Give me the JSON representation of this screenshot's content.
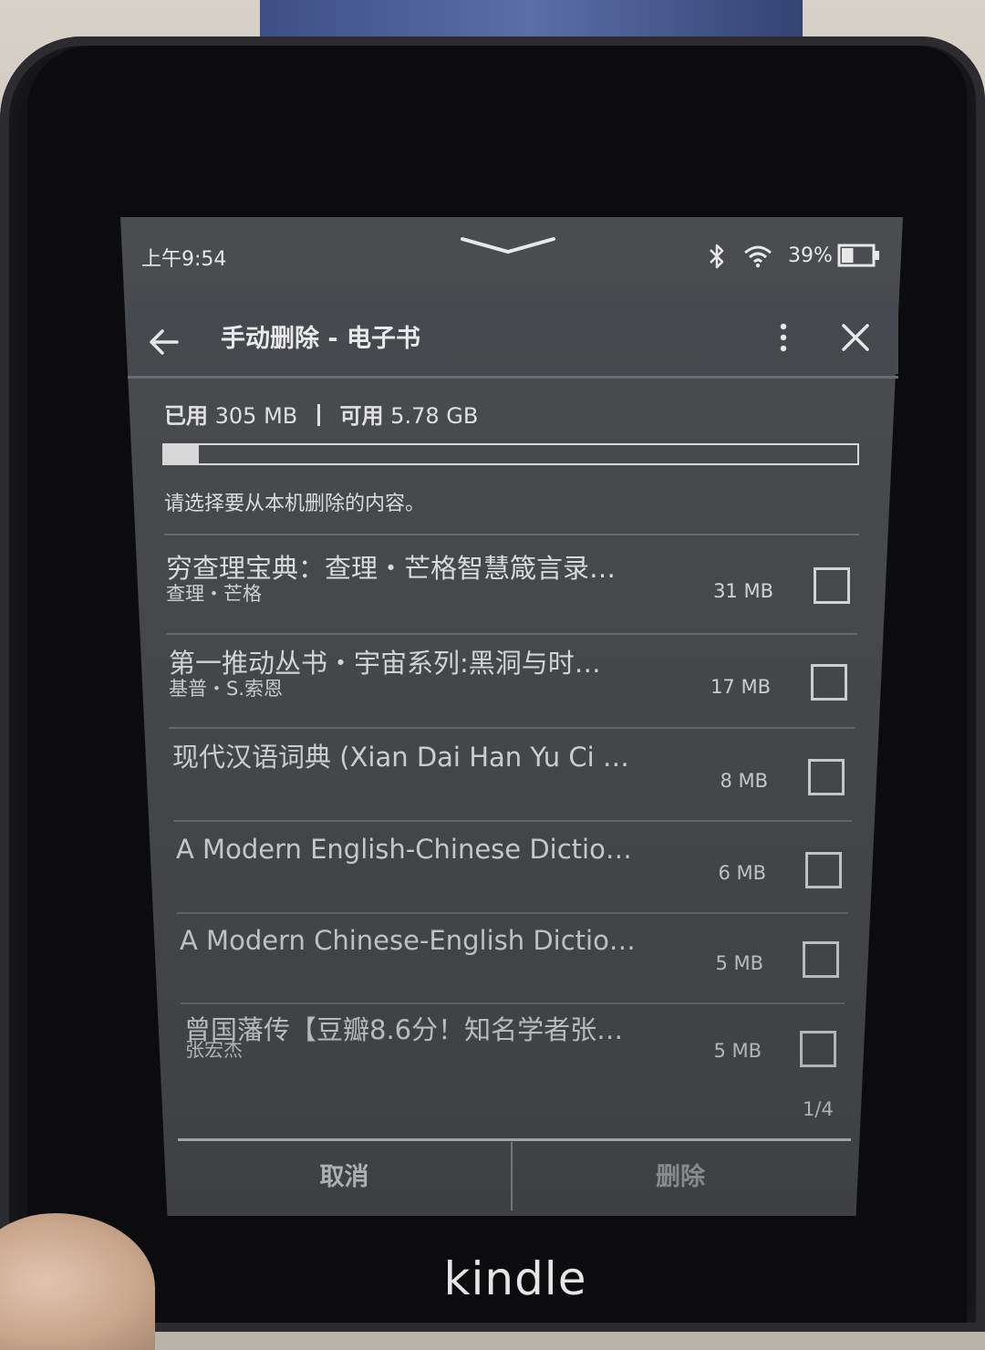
{
  "status_bar": {
    "time": "上午9:54",
    "battery_percent": "39%",
    "battery_level": 0.39
  },
  "header": {
    "title": "手动删除 - 电子书"
  },
  "storage": {
    "used_label": "已用",
    "used_value": "305 MB",
    "free_label": "可用",
    "free_value": "5.78 GB",
    "used_fraction": 0.05
  },
  "instructions": "请选择要从本机删除的内容。",
  "books": [
    {
      "title": "穷查理宝典：查理・芒格智慧箴言录…",
      "author": "查理・芒格",
      "size": "31 MB",
      "checked": false
    },
    {
      "title": "第一推动丛书・宇宙系列:黑洞与时…",
      "author": "基普・S.索恩",
      "size": "17 MB",
      "checked": false
    },
    {
      "title": "现代汉语词典 (Xian Dai Han Yu Ci …",
      "author": "",
      "size": "8 MB",
      "checked": false
    },
    {
      "title": "A Modern English-Chinese Dictio…",
      "author": "",
      "size": "6 MB",
      "checked": false
    },
    {
      "title": "A Modern Chinese-English Dictio…",
      "author": "",
      "size": "5 MB",
      "checked": false
    },
    {
      "title": "曾国藩传【豆瓣8.6分！知名学者张…",
      "author": "张宏杰",
      "size": "5 MB",
      "checked": false
    }
  ],
  "pagination": "1/4",
  "footer": {
    "cancel_label": "取消",
    "delete_label": "删除"
  },
  "device_brand": "kindle"
}
